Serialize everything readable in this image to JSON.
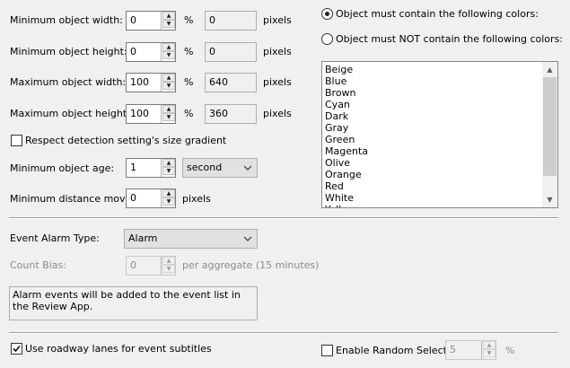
{
  "size": {
    "min_width": {
      "label": "Minimum object width:",
      "percent": "0",
      "pct_unit": "%",
      "pixels": "0",
      "px_unit": "pixels"
    },
    "min_height": {
      "label": "Minimum object height:",
      "percent": "0",
      "pct_unit": "%",
      "pixels": "0",
      "px_unit": "pixels"
    },
    "max_width": {
      "label": "Maximum object width:",
      "percent": "100",
      "pct_unit": "%",
      "pixels": "640",
      "px_unit": "pixels"
    },
    "max_height": {
      "label": "Maximum object height:",
      "percent": "100",
      "pct_unit": "%",
      "pixels": "360",
      "px_unit": "pixels"
    }
  },
  "respect_gradient": {
    "label": "Respect detection setting's size gradient",
    "checked": false
  },
  "min_age": {
    "label": "Minimum object age:",
    "value": "1",
    "unit": "second"
  },
  "min_distance": {
    "label": "Minimum distance moved:",
    "value": "0",
    "unit": "pixels"
  },
  "colors": {
    "must_contain_label": "Object must contain the following colors:",
    "must_not_contain_label": "Object must NOT contain the following colors:",
    "selected": "must_contain",
    "list": [
      "Beige",
      "Blue",
      "Brown",
      "Cyan",
      "Dark",
      "Gray",
      "Green",
      "Magenta",
      "Olive",
      "Orange",
      "Red",
      "White",
      "Yellow"
    ]
  },
  "event": {
    "alarm_type_label": "Event Alarm Type:",
    "alarm_type_value": "Alarm",
    "count_bias_label": "Count Bias:",
    "count_bias_value": "0",
    "count_bias_unit": "per aggregate (15 minutes)",
    "message": "Alarm events will be added to the event list in the Review App."
  },
  "footer": {
    "roadway_label": "Use roadway lanes for event subtitles",
    "roadway_checked": true,
    "random_label": "Enable Random Selector",
    "random_checked": false,
    "random_value": "5",
    "random_unit": "%"
  },
  "icons": {
    "spin_up": "▲",
    "spin_down": "▼",
    "check": "✓"
  }
}
